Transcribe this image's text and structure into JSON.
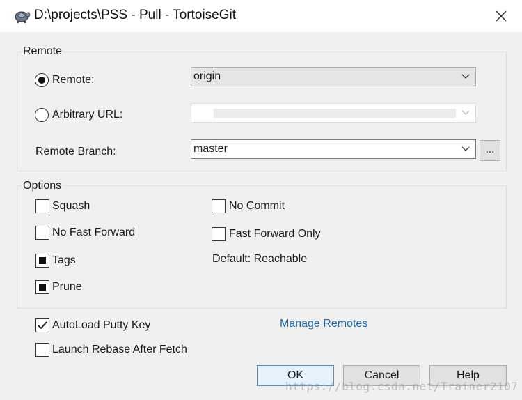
{
  "window": {
    "title": "D:\\projects\\PSS - Pull - TortoiseGit",
    "app_icon": "tortoise-icon",
    "close_icon": "close-icon"
  },
  "remote_group": {
    "label": "Remote",
    "remote_radio": {
      "label": "Remote:",
      "selected": true
    },
    "remote_combo": {
      "value": "origin"
    },
    "url_radio": {
      "label": "Arbitrary URL:",
      "selected": false
    },
    "url_combo": {
      "value": ""
    },
    "branch_label": "Remote Branch:",
    "branch_combo": {
      "value": "master"
    },
    "browse_button": "..."
  },
  "options_group": {
    "label": "Options",
    "squash": {
      "label": "Squash",
      "state": "unchecked"
    },
    "no_fast_forward": {
      "label": "No Fast Forward",
      "state": "unchecked"
    },
    "tags": {
      "label": "Tags",
      "state": "indeterminate"
    },
    "prune": {
      "label": "Prune",
      "state": "indeterminate"
    },
    "no_commit": {
      "label": "No Commit",
      "state": "unchecked"
    },
    "fast_forward_only": {
      "label": "Fast Forward Only",
      "state": "unchecked"
    },
    "default_text": "Default: Reachable"
  },
  "autoload_putty": {
    "label": "AutoLoad Putty Key",
    "state": "checked"
  },
  "launch_rebase": {
    "label": "Launch Rebase After Fetch",
    "state": "unchecked"
  },
  "manage_remotes_link": "Manage Remotes",
  "buttons": {
    "ok": "OK",
    "cancel": "Cancel",
    "help": "Help"
  },
  "watermark": "https://blog.csdn.net/Trainer2107",
  "colors": {
    "link": "#1a66a8",
    "default_button_border": "#4a90d9",
    "dialog_bg": "#f0f0f0"
  }
}
